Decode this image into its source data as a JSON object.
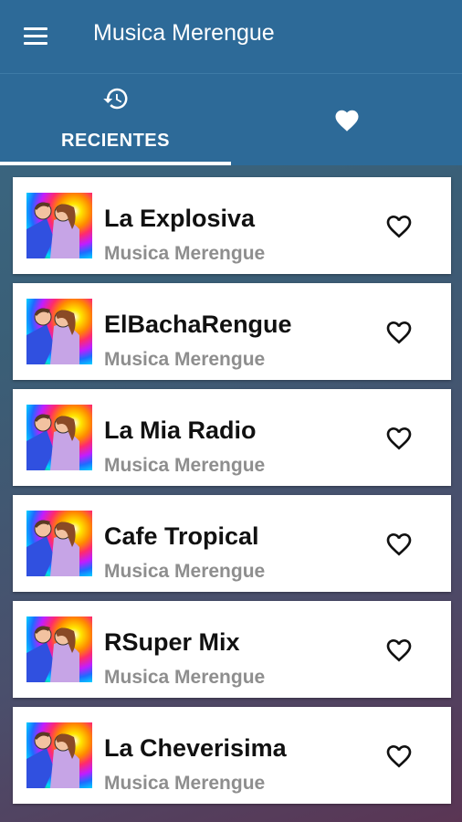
{
  "appbar": {
    "title": "Musica Merengue",
    "menu_icon": "hamburger-menu-icon"
  },
  "tabs": [
    {
      "label": "RECIENTES",
      "icon": "history-icon",
      "selected": true
    },
    {
      "label": "",
      "icon": "heart-filled-icon",
      "selected": false
    }
  ],
  "stations": [
    {
      "name": "La Explosiva",
      "genre": "Musica Merengue"
    },
    {
      "name": "ElBachaRengue",
      "genre": "Musica Merengue"
    },
    {
      "name": "La Mia Radio",
      "genre": "Musica Merengue"
    },
    {
      "name": "Cafe Tropical",
      "genre": "Musica Merengue"
    },
    {
      "name": "RSuper Mix",
      "genre": "Musica Merengue"
    },
    {
      "name": "La Cheverisima",
      "genre": "Musica Merengue"
    }
  ],
  "colors": {
    "primary": "#2d6a98",
    "card": "#ffffff",
    "subtitle": "#8e8e8e"
  }
}
